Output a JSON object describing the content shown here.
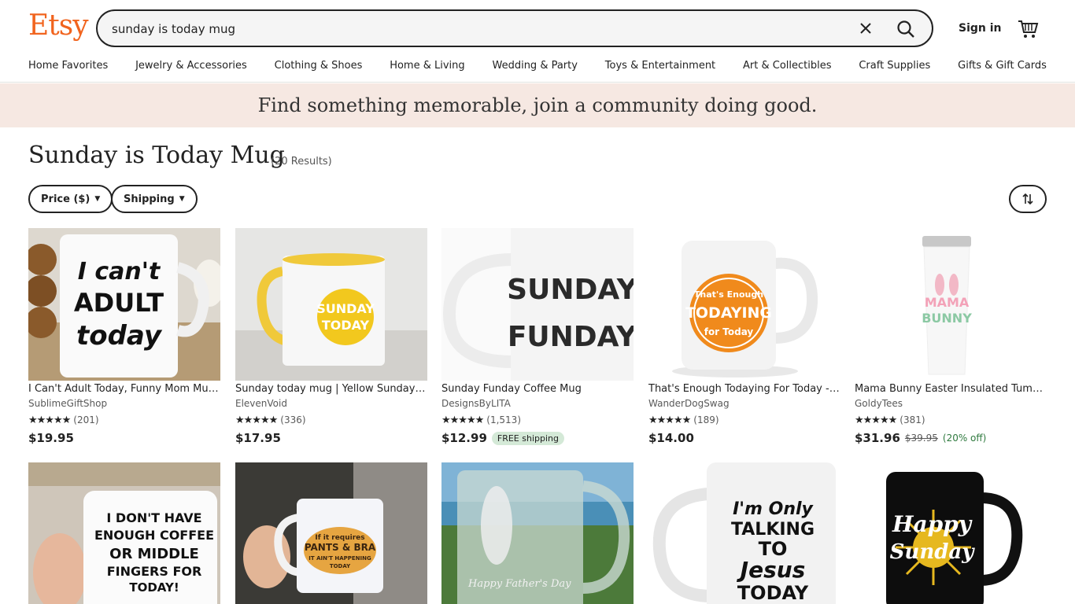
{
  "header": {
    "logo": "Etsy",
    "search_value": "sunday is today mug",
    "sign_in": "Sign in"
  },
  "nav": [
    "Home Favorites",
    "Jewelry & Accessories",
    "Clothing & Shoes",
    "Home & Living",
    "Wedding & Party",
    "Toys & Entertainment",
    "Art & Collectibles",
    "Craft Supplies",
    "Gifts & Gift Cards"
  ],
  "banner": "Find something memorable, join a community doing good.",
  "results": {
    "title": "Sunday is Today Mug",
    "count": "(20 Results)",
    "filters": [
      "Price ($)",
      "Shipping"
    ]
  },
  "colors": {
    "brand": "#f1641e",
    "banner_bg": "#f6e8e2",
    "free_shipping_bg": "#d4e9d7",
    "discount": "#2f7a3f"
  },
  "listings": [
    {
      "title": "I Can't Adult Today, Funny Mom Mug, ...",
      "shop": "SublimeGiftShop",
      "stars": "★★★★★",
      "reviews": "(201)",
      "price": "$19.95",
      "image_text": [
        "I can't",
        "ADULT",
        "today"
      ]
    },
    {
      "title": "Sunday today mug | Yellow Sunday to...",
      "shop": "ElevenVoid",
      "stars": "★★★★★",
      "reviews": "(336)",
      "price": "$17.95",
      "image_text": [
        "SUNDAY",
        "TODAY"
      ]
    },
    {
      "title": "Sunday Funday Coffee Mug",
      "shop": "DesignsByLITA",
      "stars": "★★★★★",
      "reviews": "(1,513)",
      "price": "$12.99",
      "badge": "FREE shipping",
      "image_text": [
        "SUNDAY",
        "FUNDAY"
      ]
    },
    {
      "title": "That's Enough Todaying For Today - M...",
      "shop": "WanderDogSwag",
      "stars": "★★★★★",
      "reviews": "(189)",
      "price": "$14.00",
      "image_text": [
        "That's Enough",
        "TODAYING",
        "for Today"
      ]
    },
    {
      "title": "Mama Bunny Easter Insulated Tumble...",
      "shop": "GoldyTees",
      "stars": "★★★★★",
      "reviews": "(381)",
      "price": "$31.96",
      "original_price": "$39.95",
      "discount": "(20% off)",
      "image_text": [
        "MAMA",
        "BUNNY"
      ]
    }
  ],
  "listings_row2": [
    {
      "image_text": [
        "I DON'T HAVE",
        "ENOUGH COFFEE",
        "OR MIDDLE",
        "FINGERS FOR",
        "TODAY!"
      ]
    },
    {
      "image_text": [
        "If it requires",
        "PANTS & BRA",
        "IT AIN'T HAPPENING",
        "TODAY"
      ]
    },
    {
      "image_text": [
        "Happy Father's Day"
      ]
    },
    {
      "image_text": [
        "I'm Only",
        "TALKING",
        "TO",
        "Jesus",
        "TODAY"
      ]
    },
    {
      "image_text": [
        "Happy",
        "Sunday"
      ]
    }
  ]
}
